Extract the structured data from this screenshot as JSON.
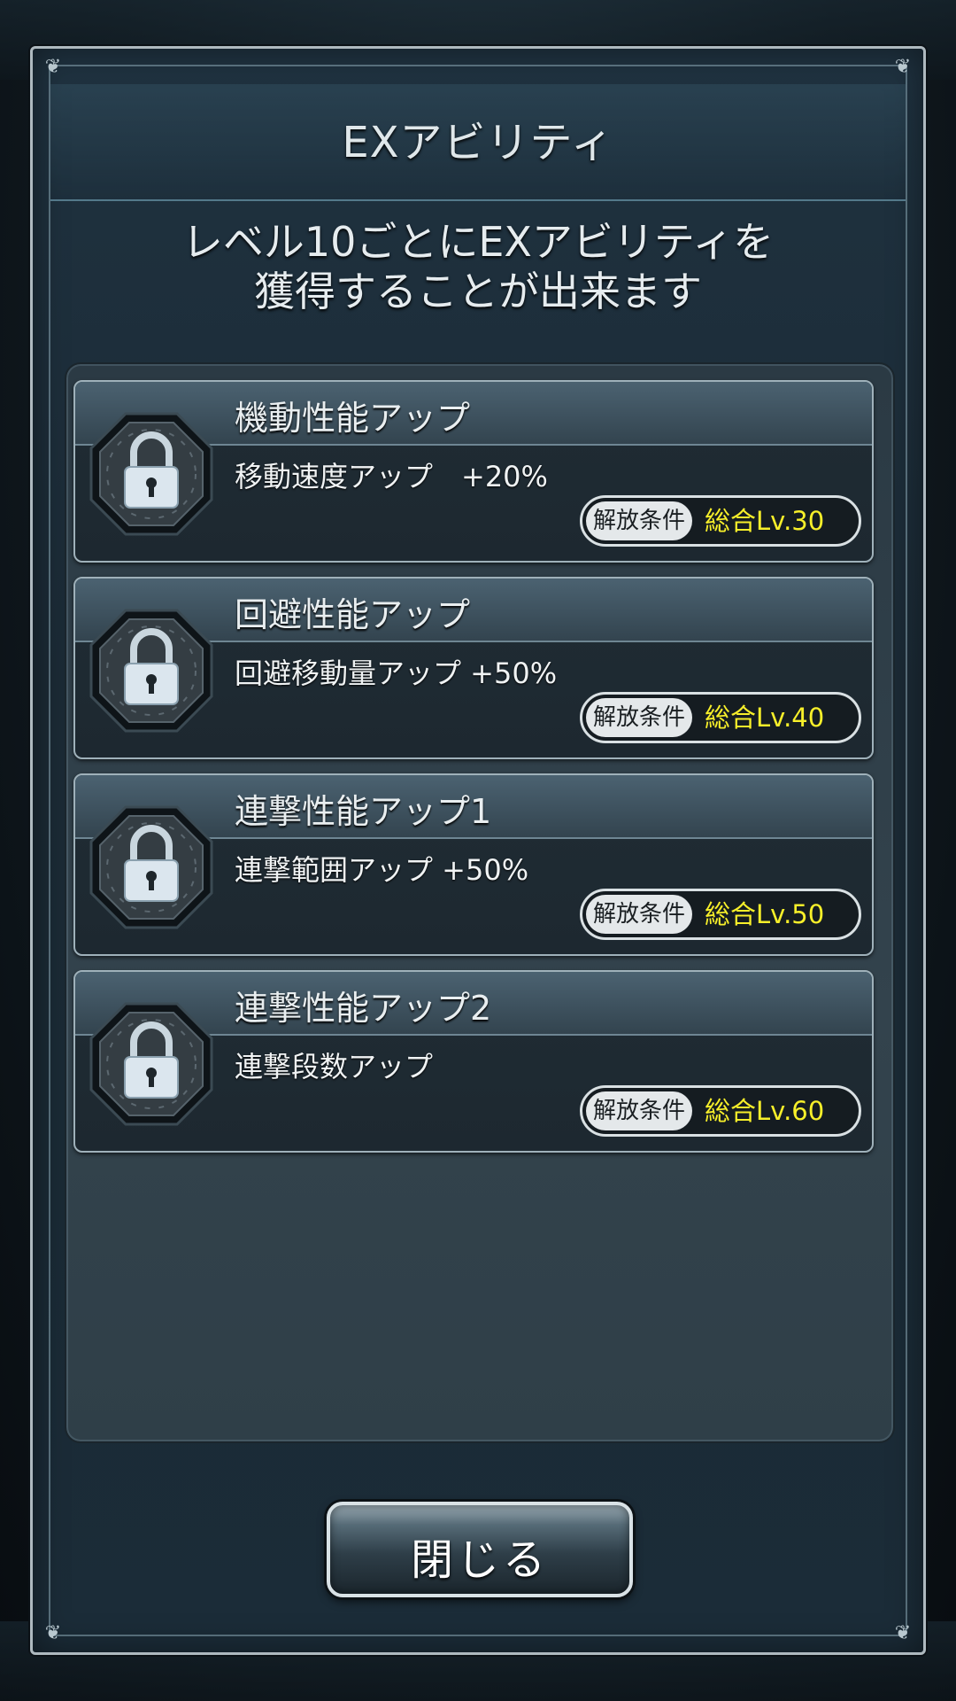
{
  "dialog": {
    "title": "EXアビリティ",
    "description_line1": "レベル10ごとにEXアビリティを",
    "description_line2": "獲得することが出来ます",
    "close_label": "閉じる"
  },
  "abilities": [
    {
      "name": "機動性能アップ",
      "effect": "移動速度アップ　+20%",
      "condition_label": "解放条件",
      "condition_value": "総合Lv.30",
      "icon": "lock-icon",
      "locked": true
    },
    {
      "name": "回避性能アップ",
      "effect": "回避移動量アップ +50%",
      "condition_label": "解放条件",
      "condition_value": "総合Lv.40",
      "icon": "lock-icon",
      "locked": true
    },
    {
      "name": "連撃性能アップ1",
      "effect": "連撃範囲アップ +50%",
      "condition_label": "解放条件",
      "condition_value": "総合Lv.50",
      "icon": "lock-icon",
      "locked": true
    },
    {
      "name": "連撃性能アップ2",
      "effect": "連撃段数アップ",
      "condition_label": "解放条件",
      "condition_value": "総合Lv.60",
      "icon": "lock-icon",
      "locked": true
    }
  ],
  "colors": {
    "condition_value": "#f7ef2a",
    "frame": "#aeb9bf",
    "panel": "#33434d"
  }
}
